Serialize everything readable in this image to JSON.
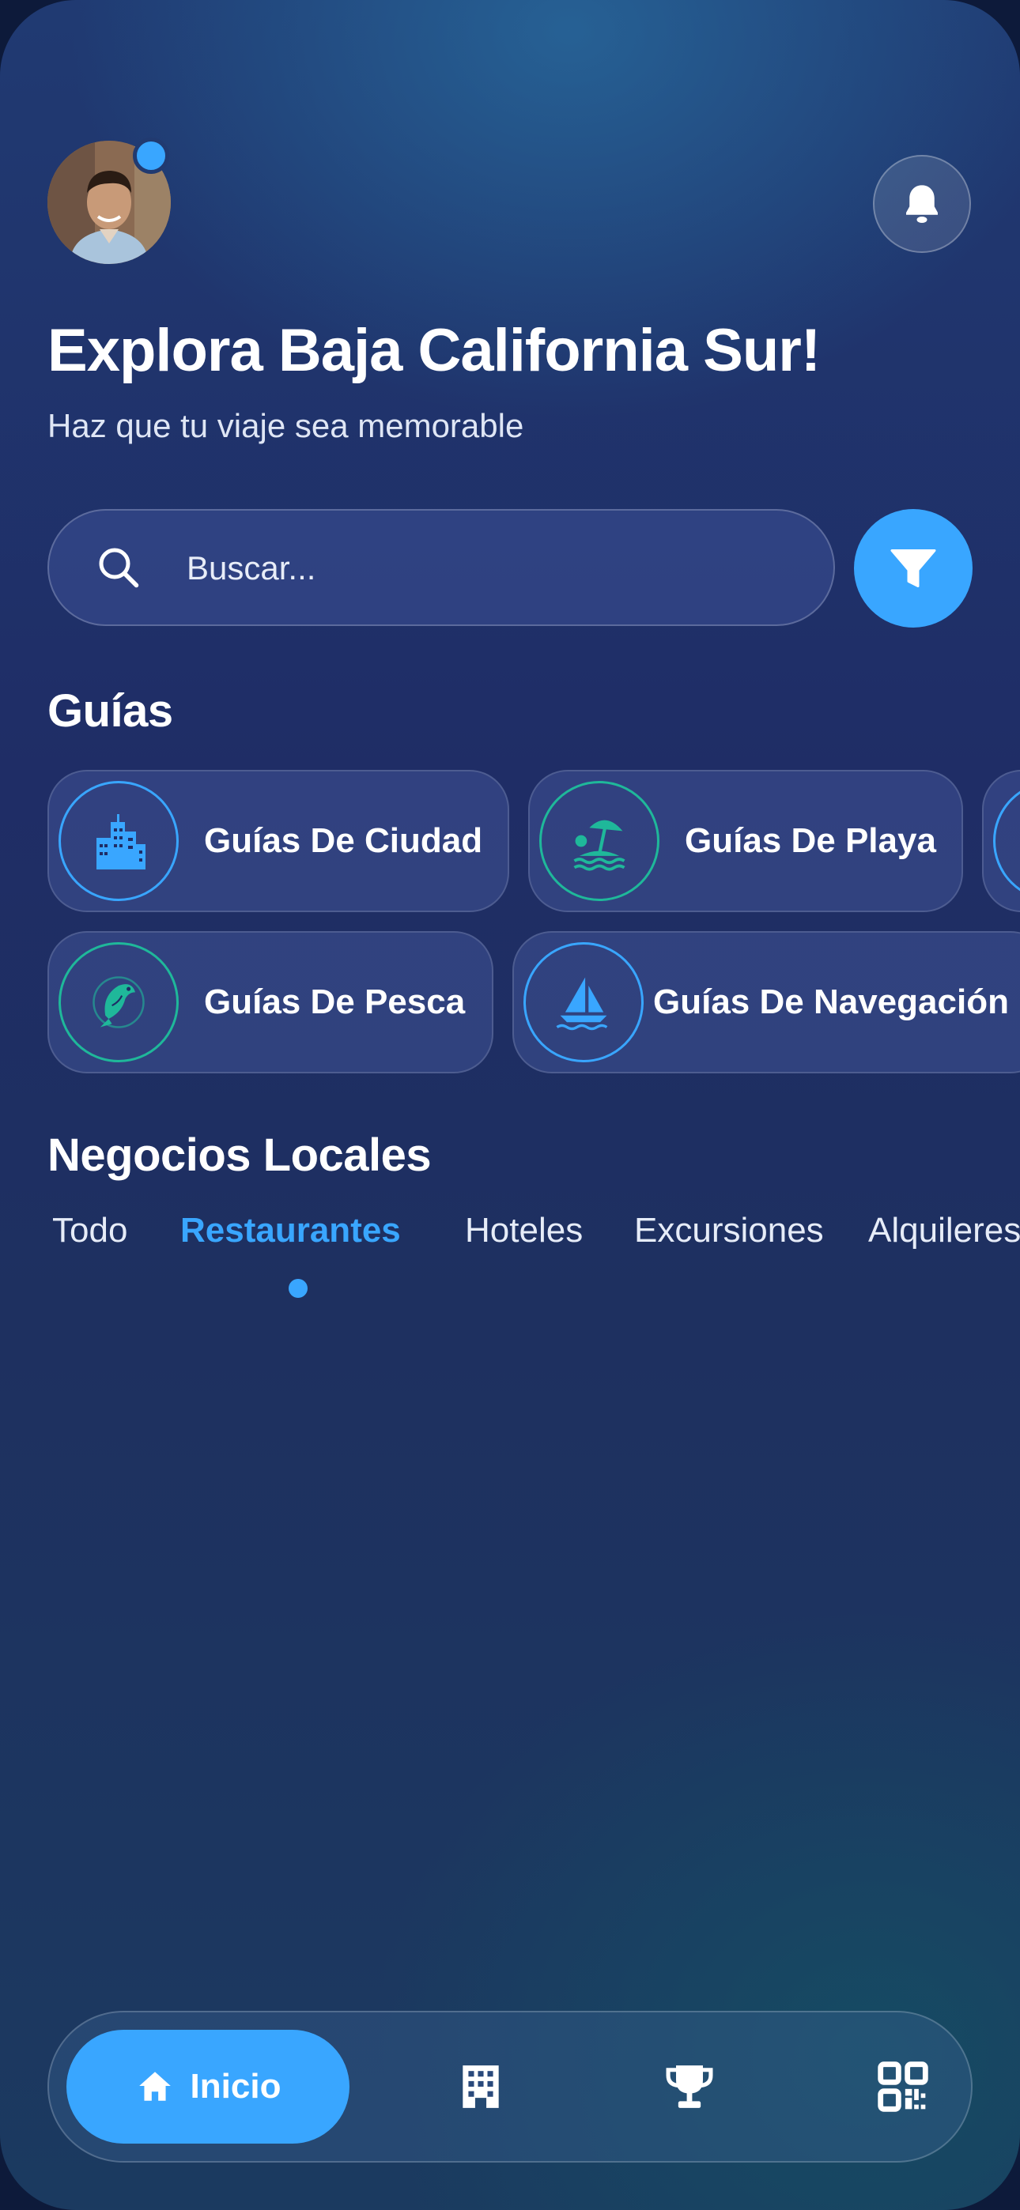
{
  "header": {
    "avatar_icon": "user-avatar",
    "notification_icon": "bell-icon",
    "title": "Explora Baja California Sur!",
    "subtitle": "Haz que tu viaje sea memorable"
  },
  "search": {
    "placeholder": "Buscar...",
    "icon": "search-icon",
    "filter_icon": "filter-icon"
  },
  "guides": {
    "title": "Guías",
    "items": [
      {
        "label": "Guías De Ciudad",
        "icon": "city-icon"
      },
      {
        "label": "Guías De Playa",
        "icon": "beach-icon"
      },
      {
        "label": "Guías De Pesca",
        "icon": "fish-icon"
      },
      {
        "label": "Guías De Navegación",
        "icon": "sailboat-icon"
      }
    ]
  },
  "businesses": {
    "title": "Negocios Locales",
    "tabs": [
      "Todo",
      "Restaurantes",
      "Hoteles",
      "Excursiones",
      "Alquileres"
    ],
    "active_tab": "Restaurantes"
  },
  "navbar": {
    "home_label": "Inicio",
    "items": [
      "home-icon",
      "building-icon",
      "trophy-icon",
      "qr-code-icon"
    ]
  },
  "colors": {
    "accent": "#39a6ff",
    "teal": "#1fb89a",
    "background": "#1f2d66"
  }
}
